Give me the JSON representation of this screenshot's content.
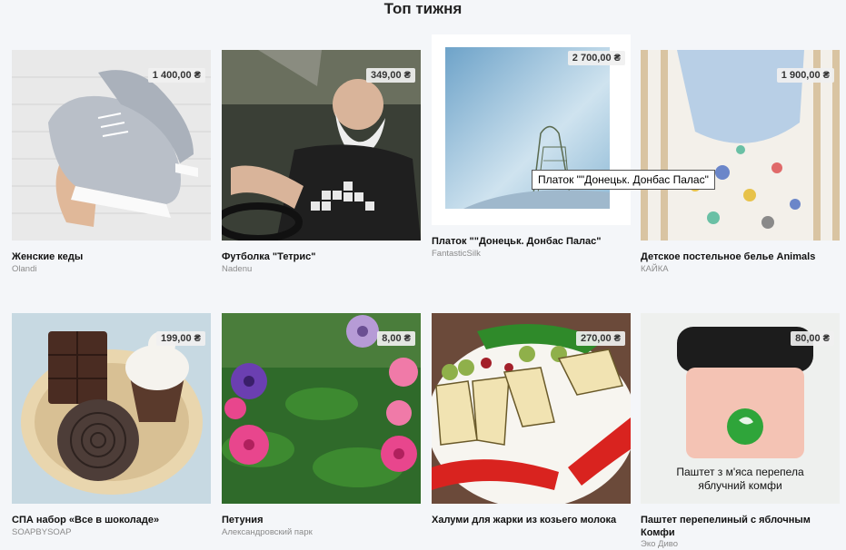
{
  "section": {
    "title": "Топ тижня"
  },
  "products": [
    {
      "name": "Женские кеды",
      "seller": "Olandi",
      "price": "1 400,00 ₴",
      "image": "grey-sneakers-photo"
    },
    {
      "name": "Футболка \"Тетрис\"",
      "seller": "Nadenu",
      "price": "349,00 ₴",
      "image": "bearded-man-tetris-tshirt-photo"
    },
    {
      "name": "Платок  \"\"Донецьк. Донбас Палас\"",
      "seller": "FantasticSilk",
      "price": "2 700,00 ₴",
      "image": "silk-scarf-painting-photo"
    },
    {
      "name": "Детское постельное белье Animals",
      "seller": "КАЙКА",
      "price": "1 900,00 ₴",
      "image": "kids-bedding-animals-photo"
    },
    {
      "name": "СПА набор «Все в шоколаде»",
      "seller": "SOAPBYSOAP",
      "price": "199,00 ₴",
      "image": "chocolate-soap-set-photo"
    },
    {
      "name": "Петуния",
      "seller": "Александровский парк",
      "price": "8,00 ₴",
      "image": "petunia-flowers-photo"
    },
    {
      "name": "Халуми для жарки из козьего молока",
      "seller": "",
      "price": "270,00 ₴",
      "image": "halloumi-plate-photo"
    },
    {
      "name": "Паштет перепелиный с яблочным Комфи",
      "seller": "Эко Диво",
      "price": "80,00 ₴",
      "image": "quail-pate-jar-photo",
      "jar_caption_1": "Паштет з м'яса перепела",
      "jar_caption_2": "яблучний комфи"
    }
  ],
  "tooltip": {
    "text": "Платок  \"\"Донецьк. Донбас Палас\""
  },
  "colors": {
    "background": "#f4f6f9",
    "price_badge": "#f0f0f0"
  }
}
